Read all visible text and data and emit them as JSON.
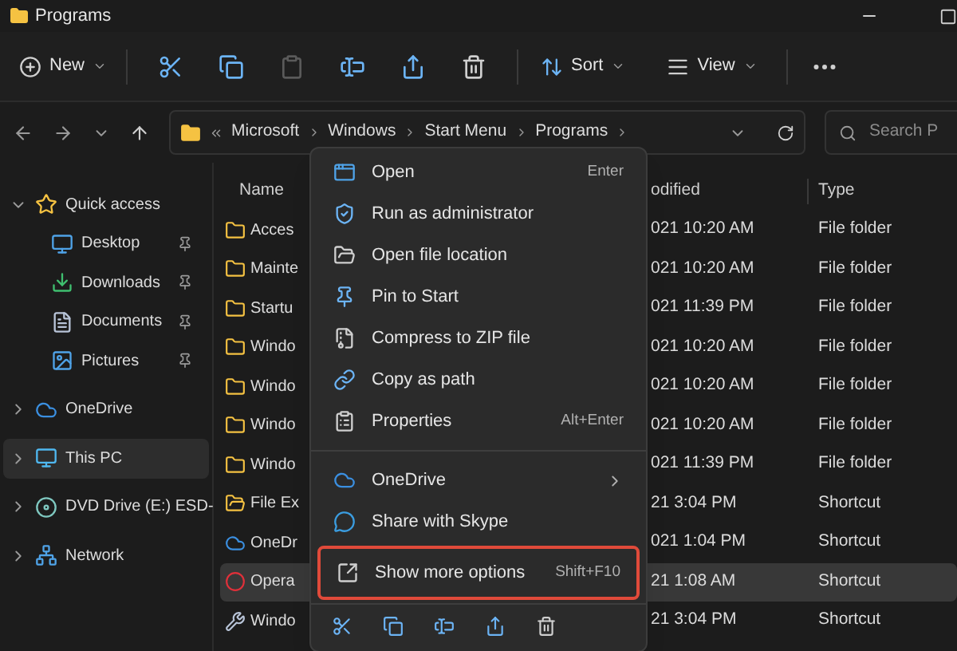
{
  "window": {
    "title": "Programs"
  },
  "toolbar": {
    "new": {
      "label": "New"
    },
    "actions": [
      {
        "kind": "cut",
        "disabled": false
      },
      {
        "kind": "copy",
        "disabled": false
      },
      {
        "kind": "paste",
        "disabled": true
      },
      {
        "kind": "rename",
        "disabled": false
      },
      {
        "kind": "share",
        "disabled": false
      },
      {
        "kind": "delete",
        "disabled": false
      }
    ],
    "sort": {
      "label": "Sort"
    },
    "view": {
      "label": "View"
    }
  },
  "address": {
    "segments": [
      "Microsoft",
      "Windows",
      "Start Menu",
      "Programs"
    ],
    "search_placeholder": "Search P"
  },
  "sidebar": {
    "items": [
      {
        "kind": "star",
        "label": "Quick access",
        "expanded": true,
        "selected": false,
        "children": [
          {
            "kind": "desktop",
            "label": "Desktop",
            "pinned": true,
            "selected": false
          },
          {
            "kind": "download",
            "label": "Downloads",
            "pinned": true,
            "selected": false
          },
          {
            "kind": "document",
            "label": "Documents",
            "pinned": true,
            "selected": false
          },
          {
            "kind": "picture",
            "label": "Pictures",
            "pinned": true,
            "selected": false
          }
        ]
      },
      {
        "kind": "cloud",
        "label": "OneDrive",
        "expanded": false,
        "selected": false
      },
      {
        "kind": "pc",
        "label": "This PC",
        "expanded": false,
        "selected": true
      },
      {
        "kind": "disc",
        "label": "DVD Drive (E:) ESD-",
        "expanded": false,
        "selected": false
      },
      {
        "kind": "network",
        "label": "Network",
        "expanded": false,
        "selected": false
      }
    ]
  },
  "files": {
    "columns": [
      "Name",
      "odified",
      "Type"
    ],
    "rows": [
      {
        "kind": "folder",
        "name": "Acces",
        "modified": "021 10:20 AM",
        "type": "File folder",
        "selected": false
      },
      {
        "kind": "folder",
        "name": "Mainte",
        "modified": "021 10:20 AM",
        "type": "File folder",
        "selected": false
      },
      {
        "kind": "folder",
        "name": "Startu",
        "modified": "021 11:39 PM",
        "type": "File folder",
        "selected": false
      },
      {
        "kind": "folder",
        "name": "Windo",
        "modified": "021 10:20 AM",
        "type": "File folder",
        "selected": false
      },
      {
        "kind": "folder",
        "name": "Windo",
        "modified": "021 10:20 AM",
        "type": "File folder",
        "selected": false
      },
      {
        "kind": "folder",
        "name": "Windo",
        "modified": "021 10:20 AM",
        "type": "File folder",
        "selected": false
      },
      {
        "kind": "folder",
        "name": "Windo",
        "modified": "021 11:39 PM",
        "type": "File folder",
        "selected": false
      },
      {
        "kind": "explorer",
        "name": "File Ex",
        "modified": "21 3:04 PM",
        "type": "Shortcut",
        "selected": false
      },
      {
        "kind": "onedrive",
        "name": "OneDr",
        "modified": "021 1:04 PM",
        "type": "Shortcut",
        "selected": false
      },
      {
        "kind": "opera",
        "name": "Opera",
        "modified": "21 1:08 AM",
        "type": "Shortcut",
        "selected": true
      },
      {
        "kind": "tool",
        "name": "Windo",
        "modified": "21 3:04 PM",
        "type": "Shortcut",
        "selected": false
      }
    ]
  },
  "context_menu": {
    "items": [
      {
        "kind": "open",
        "label": "Open",
        "shortcut": "Enter",
        "submenu": false,
        "highlighted": false
      },
      {
        "kind": "admin",
        "label": "Run as administrator",
        "submenu": false,
        "highlighted": false
      },
      {
        "kind": "location",
        "label": "Open file location",
        "submenu": false,
        "highlighted": false
      },
      {
        "kind": "pin",
        "label": "Pin to Start",
        "submenu": false,
        "highlighted": false
      },
      {
        "kind": "zip",
        "label": "Compress to ZIP file",
        "submenu": false,
        "highlighted": false
      },
      {
        "kind": "path",
        "label": "Copy as path",
        "submenu": false,
        "highlighted": false
      },
      {
        "kind": "properties",
        "label": "Properties",
        "shortcut": "Alt+Enter",
        "submenu": false,
        "highlighted": false
      },
      {
        "kind": "separator"
      },
      {
        "kind": "onedrive",
        "label": "OneDrive",
        "submenu": true,
        "highlighted": false
      },
      {
        "kind": "skype",
        "label": "Share with Skype",
        "submenu": false,
        "highlighted": false
      },
      {
        "kind": "more",
        "label": "Show more options",
        "shortcut": "Shift+F10",
        "submenu": false,
        "highlighted": true
      }
    ],
    "actions": [
      {
        "kind": "cut"
      },
      {
        "kind": "copy"
      },
      {
        "kind": "rename"
      },
      {
        "kind": "share"
      },
      {
        "kind": "delete"
      }
    ]
  }
}
